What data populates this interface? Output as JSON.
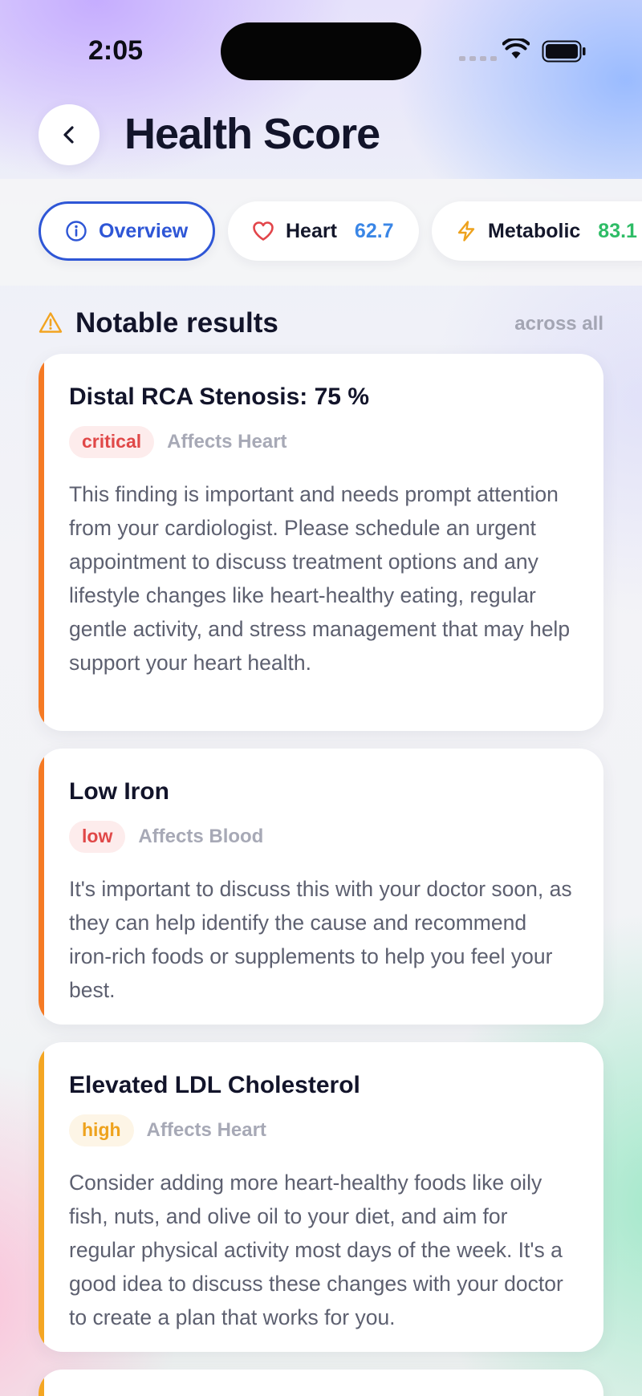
{
  "status_bar": {
    "time": "2:05"
  },
  "header": {
    "title": "Health Score"
  },
  "tabs": [
    {
      "label": "Overview",
      "icon": "info-icon",
      "active": true
    },
    {
      "label": "Heart",
      "icon": "heart-icon",
      "score": "62.7",
      "score_color": "#3a86e6"
    },
    {
      "label": "Metabolic",
      "icon": "lightning-icon",
      "score": "83.1",
      "score_color": "#2ebc66"
    }
  ],
  "section": {
    "title": "Notable results",
    "aside": "across all",
    "icon": "warning-icon"
  },
  "results": [
    {
      "title": "Distal RCA Stenosis: 75 %",
      "badge": "critical",
      "affects": "Affects Heart",
      "body": "This finding is important and needs prompt attention from your cardiologist. Please schedule an urgent appointment to discuss treatment options and any lifestyle changes like heart-healthy eating, regular gentle activity, and stress management that may help support your heart health.",
      "accent": "#f57a24"
    },
    {
      "title": "Low Iron",
      "badge": "low",
      "affects": "Affects Blood",
      "body": "It's important to discuss this with your doctor soon, as they can help identify the cause and recommend iron-rich foods or supplements to help you feel your best.",
      "accent": "#f57a24"
    },
    {
      "title": "Elevated LDL Cholesterol",
      "badge": "high",
      "affects": "Affects Heart",
      "body": "Consider adding more heart-healthy foods like oily fish, nuts, and olive oil to your diet, and aim for regular physical activity most days of the week. It's a good idea to discuss these changes with your doctor to create a plan that works for you.",
      "accent": "#f4a623"
    }
  ]
}
